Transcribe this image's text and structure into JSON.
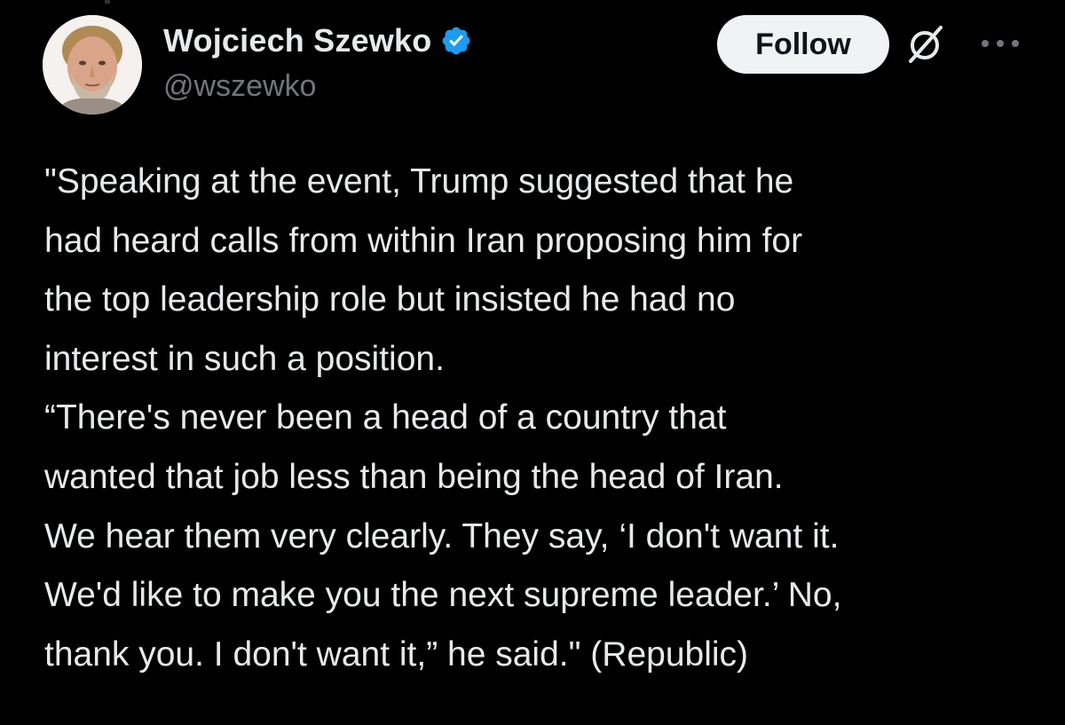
{
  "author": {
    "display_name": "Wojciech Szewko",
    "handle": "@wszewko",
    "verified": true,
    "verified_color": "#1d9bf0"
  },
  "actions": {
    "follow_label": "Follow",
    "grok_icon": "grok-slash-icon",
    "more_icon": "more-horizontal-icon"
  },
  "tweet": {
    "lines": [
      "\"Speaking at the event, Trump suggested that he",
      "had heard calls from within Iran proposing him for",
      "the top leadership role but insisted he had no",
      "interest in such a position.",
      "“There's never been a head of a country that",
      "wanted that job less than being the head of Iran.",
      "We hear them very clearly. They say, ‘I don't want it.",
      "We'd like to make you the next supreme leader.’ No,",
      "thank you. I don't want it,” he said.\" (Republic)"
    ]
  },
  "colors": {
    "background": "#000000",
    "text_primary": "#e7e9ea",
    "text_secondary": "#71767b",
    "follow_bg": "#eff3f4",
    "follow_text": "#0f1419"
  }
}
